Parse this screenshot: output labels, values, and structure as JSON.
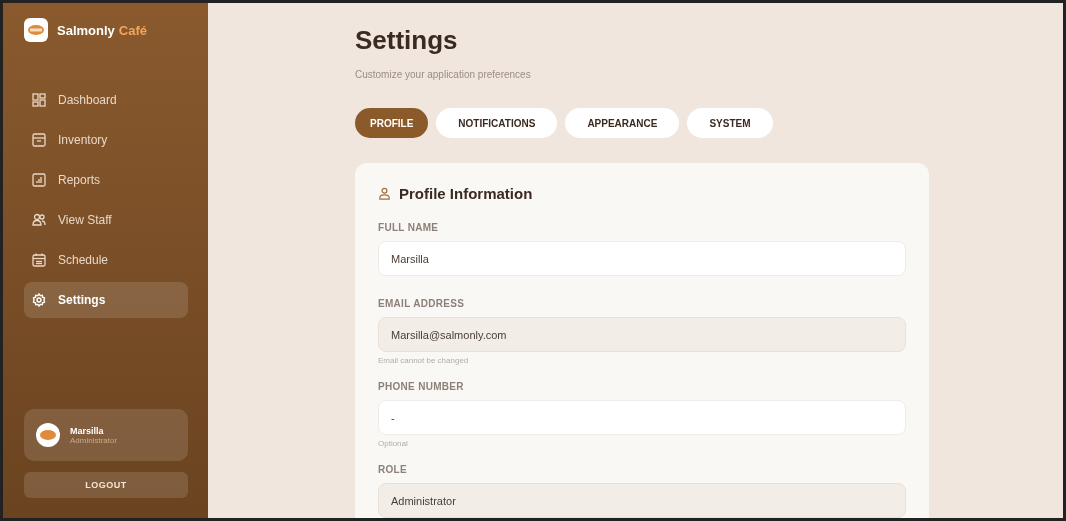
{
  "sidebar": {
    "brand": {
      "name": "Salmonly",
      "accent": "Café"
    },
    "items": [
      {
        "label": "Dashboard",
        "selected": false
      },
      {
        "label": "Inventory",
        "selected": false
      },
      {
        "label": "Reports",
        "selected": false
      },
      {
        "label": "View Staff",
        "selected": false
      },
      {
        "label": "Schedule",
        "selected": false
      },
      {
        "label": "Settings",
        "selected": true
      }
    ],
    "user": {
      "name": "Marsilla",
      "role": "Administrator"
    },
    "logout": "LOGOUT"
  },
  "header": {
    "title": "Settings",
    "subtitle": "Customize your application preferences"
  },
  "tabs": [
    {
      "label": "PROFILE",
      "selected": true
    },
    {
      "label": "NOTIFICATIONS",
      "selected": false
    },
    {
      "label": "APPEARANCE",
      "selected": false
    },
    {
      "label": "SYSTEM",
      "selected": false
    }
  ],
  "card": {
    "title": "Profile Information",
    "fields": [
      {
        "label": "FULL NAME",
        "value": "Marsilla",
        "disabled": false
      },
      {
        "label": "EMAIL ADDRESS",
        "value": "Marsilla@salmonly.com",
        "disabled": true,
        "hint": "Email cannot be changed"
      },
      {
        "label": "PHONE NUMBER",
        "value": "-",
        "disabled": false,
        "hint": "Optional"
      },
      {
        "label": "ROLE",
        "value": "Administrator",
        "disabled": true
      }
    ]
  }
}
